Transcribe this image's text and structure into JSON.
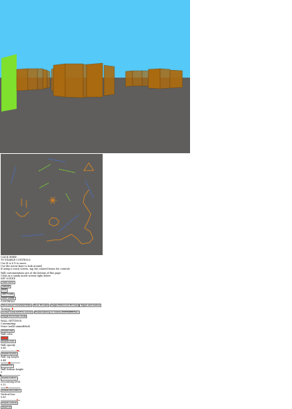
{
  "scene": {
    "sky_color": "#55c9f7",
    "floor_color": "#5f5e5c",
    "wall_color": "#aa6a10",
    "highlight_wall_color": "#7fe02e",
    "map_background": "#5f5e5c",
    "map_path_color": "#e8891c",
    "map_blue_color": "#4a6fc9",
    "map_green_color": "#7fe02e"
  },
  "controls": {
    "lines": [
      "CLICK HERE",
      "TO ENABLE CONTROLS",
      "Use W A S D to move",
      "Use the arrow keys to look around",
      "If using a touch screen, tap the colored boxes for controls"
    ],
    "map_lines": [
      "Wall customizations are at the bottom of this page",
      "Click on a sandy mode screen right below",
      "SET SCENE"
    ],
    "scene_buttons": [
      "reset scene",
      "CREATE",
      "EXIT",
      "SEE FLOOR",
      "HIDE SCENE"
    ],
    "controls_label": "CONTROLS",
    "controls_buttons": [
      "Move player translate/rotate",
      "Move 3D walls",
      "Toggle flat/curved 3D view",
      "Toggle wall shadow"
    ],
    "turning_label": "Turning",
    "turning_buttons": [
      "Locked mode (Shift to unlock)",
      "Enable tabbing on mobile (EXPERIMENTAL)"
    ],
    "toggle_buttons": [
      "Toggle full-screen mode"
    ],
    "wall_settings_label": "WALL SETTINGS",
    "customizing_label": "Customizing",
    "selected_wall_label": "None (walls unmodified)",
    "delete_wall_button": "Delete wall",
    "wall_color_label": "Wall color",
    "wall_color_value": "#e03a2a",
    "delete_color_button": "Delete color",
    "wall_opacity_label": "Wall opacity",
    "opacity_value": "0.88",
    "opacity_level": 0.88,
    "delete_opacity_button": "Delete opacity",
    "wall_top_label": "Wall top height",
    "top_value": "0.44",
    "top_level": 0.44,
    "delete_top_button": "Delete top",
    "wall_bottom_label": "Wall bottom height",
    "bottom_value": "0",
    "bottom_level": 0.0,
    "delete_bottom_button": "Delete bottom",
    "decoration_label": "Decorating level",
    "decoration_value": "0.32",
    "decoration_level": 0.32,
    "delete_decoration_button": "Delete decoration",
    "vertical_label": "Vertical line",
    "vertical_value": "0.85",
    "vertical_level": 0.85,
    "delete_vertical_button": "Delete vertical",
    "reset_button": "Reset all"
  }
}
